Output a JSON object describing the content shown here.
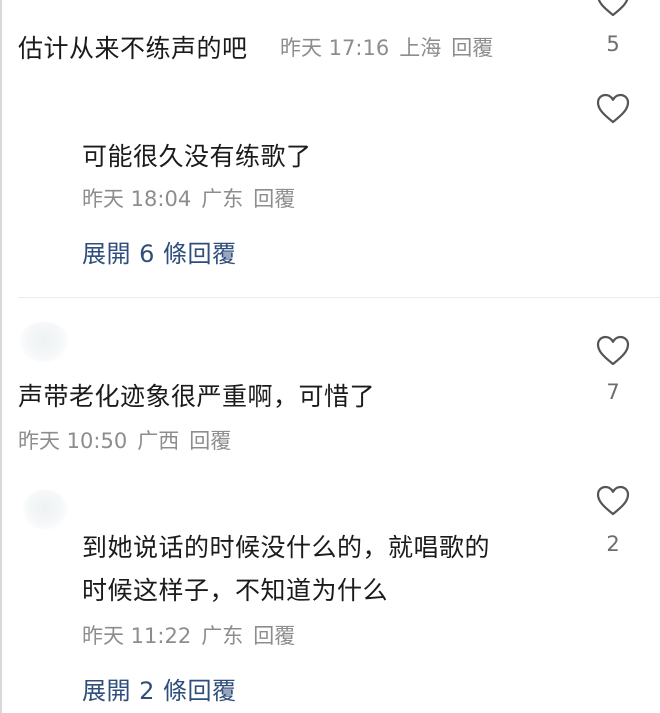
{
  "comments": [
    {
      "text": "估计从来不练声的吧",
      "time": "昨天 17:16",
      "location": "上海",
      "reply_label": "回覆",
      "likes": "5"
    },
    {
      "text": "可能很久没有练歌了",
      "time": "昨天 18:04",
      "location": "广东",
      "reply_label": "回覆",
      "expand_label": "展開 6 條回覆"
    },
    {
      "text": "声带老化迹象很严重啊，可惜了",
      "time": "昨天 10:50",
      "location": "广西",
      "reply_label": "回覆",
      "likes": "7"
    },
    {
      "text_line1": "到她说话的时候没什么的，就唱歌的",
      "text_line2": "时候这样子，不知道为什么",
      "time": "昨天 11:22",
      "location": "广东",
      "reply_label": "回覆",
      "likes": "2",
      "expand_label": "展開 2 條回覆"
    }
  ],
  "icons": {
    "like": "heart-outline-icon"
  }
}
